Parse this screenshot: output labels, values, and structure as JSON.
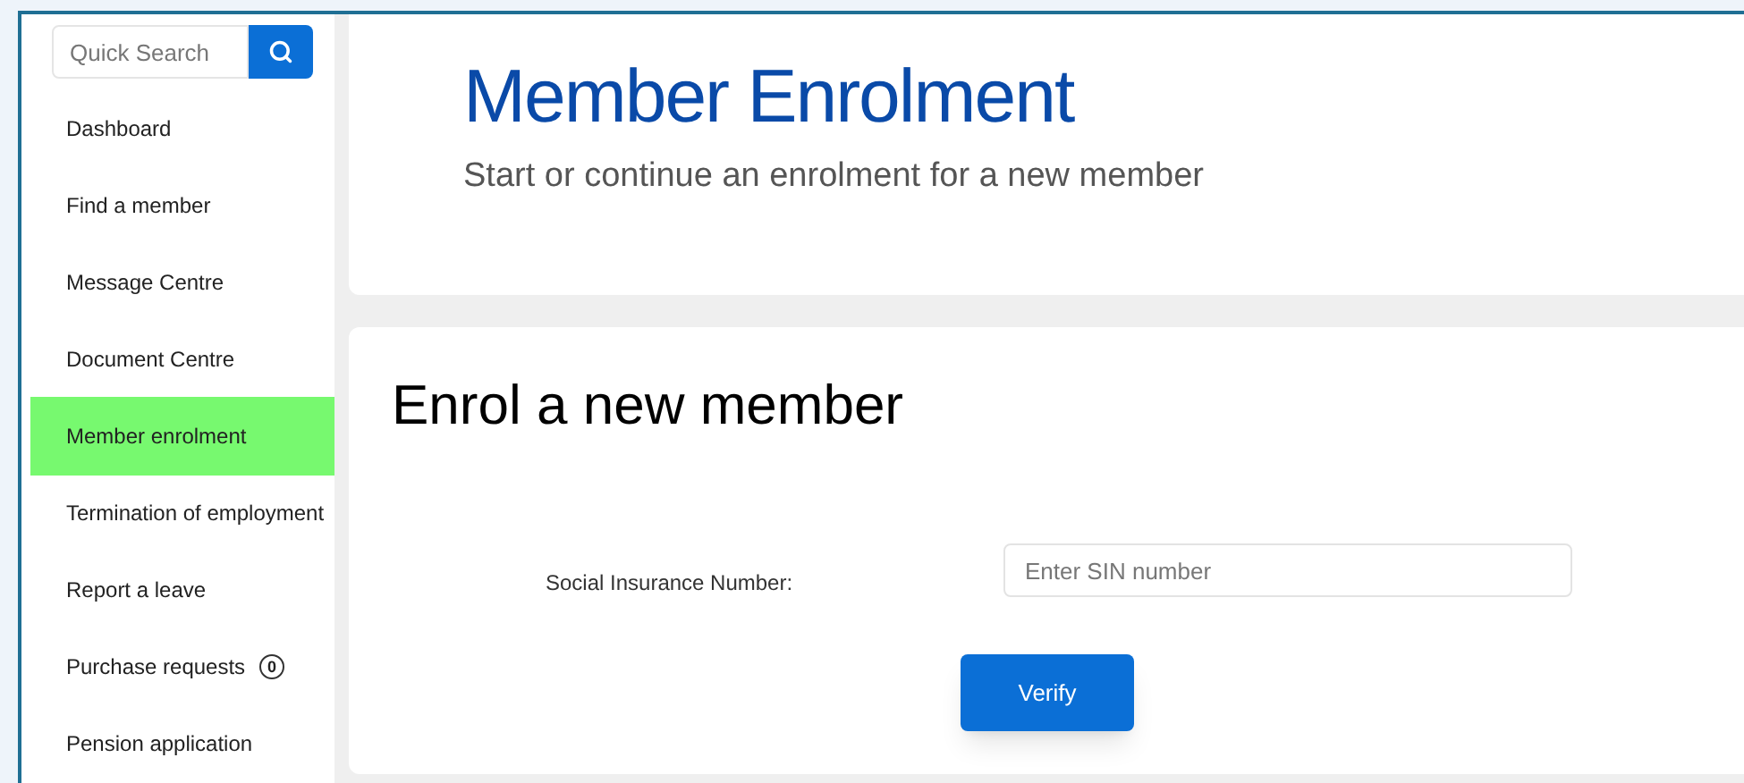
{
  "sidebar": {
    "search": {
      "placeholder": "Quick Search"
    },
    "items": [
      {
        "label": "Dashboard",
        "selected": false
      },
      {
        "label": "Find a member",
        "selected": false
      },
      {
        "label": "Message Centre",
        "selected": false
      },
      {
        "label": "Document Centre",
        "selected": false
      },
      {
        "label": "Member enrolment",
        "selected": true
      },
      {
        "label": "Termination of employment",
        "selected": false
      },
      {
        "label": "Report a leave",
        "selected": false
      },
      {
        "label": "Purchase requests",
        "selected": false,
        "badge": "0"
      },
      {
        "label": "Pension application",
        "selected": false
      }
    ]
  },
  "header": {
    "title": "Member Enrolment",
    "subtitle": "Start or continue an enrolment for a new member"
  },
  "form": {
    "title": "Enrol a new member",
    "field_label": "Social Insurance Number:",
    "placeholder": "Enter SIN number",
    "button": "Verify"
  }
}
